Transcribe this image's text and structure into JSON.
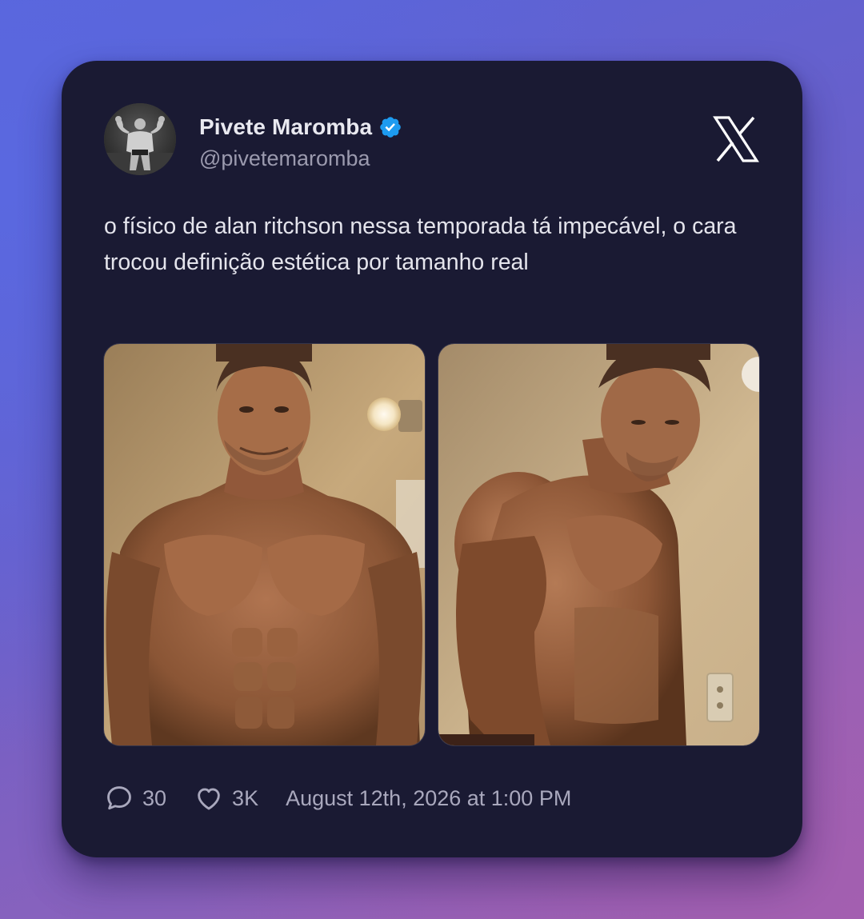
{
  "tweet": {
    "author": {
      "name": "Pivete Maromba",
      "handle": "@pivetemaromba",
      "verified": true,
      "avatar_icon": "bodybuilder-photo"
    },
    "platform_icon": "x-logo-icon",
    "text": "o físico de alan ritchson nessa temporada tá impecável, o cara trocou definição estética por tamanho real",
    "media": [
      {
        "icon": "shirtless-man-front-photo"
      },
      {
        "icon": "shirtless-man-side-photo"
      }
    ],
    "stats": {
      "replies": "30",
      "likes": "3K",
      "timestamp": "August 12th, 2026 at 1:00 PM"
    }
  },
  "colors": {
    "card_background": "#1a1a33",
    "verified_badge": "#1d9bf0",
    "primary_text": "#e9e9f0",
    "secondary_text": "#9b9aae"
  }
}
